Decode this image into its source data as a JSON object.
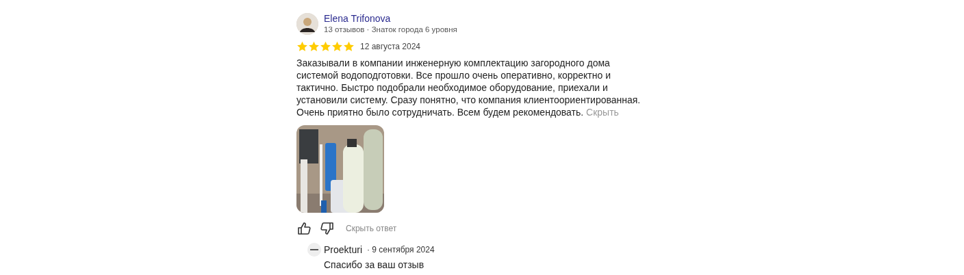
{
  "review": {
    "author": "Elena Trifonova",
    "author_meta": "13 отзывов · Знаток города 6 уровня",
    "stars": 5,
    "date": "12 августа 2024",
    "text": "Заказывали в компании инженерную комплектацию загородного дома системой водоподготовки. Все прошло очень оперативно, корректно и тактично. Быстро подобрали необходимое оборудование, приехали и установили систему. Сразу понятно, что компания клиентоориентированная. Очень приятно было сотрудничать. Всем будем рекомендовать.",
    "collapse_link": "Скрыть",
    "photos": [
      {
        "kind": "picture"
      }
    ],
    "liked": false,
    "disliked": false,
    "toggle_reply": "Скрыть ответ"
  },
  "reply": {
    "author": "Proekturi",
    "date": "· 9 сентября 2024",
    "text": "Спасибо за ваш отзыв"
  }
}
